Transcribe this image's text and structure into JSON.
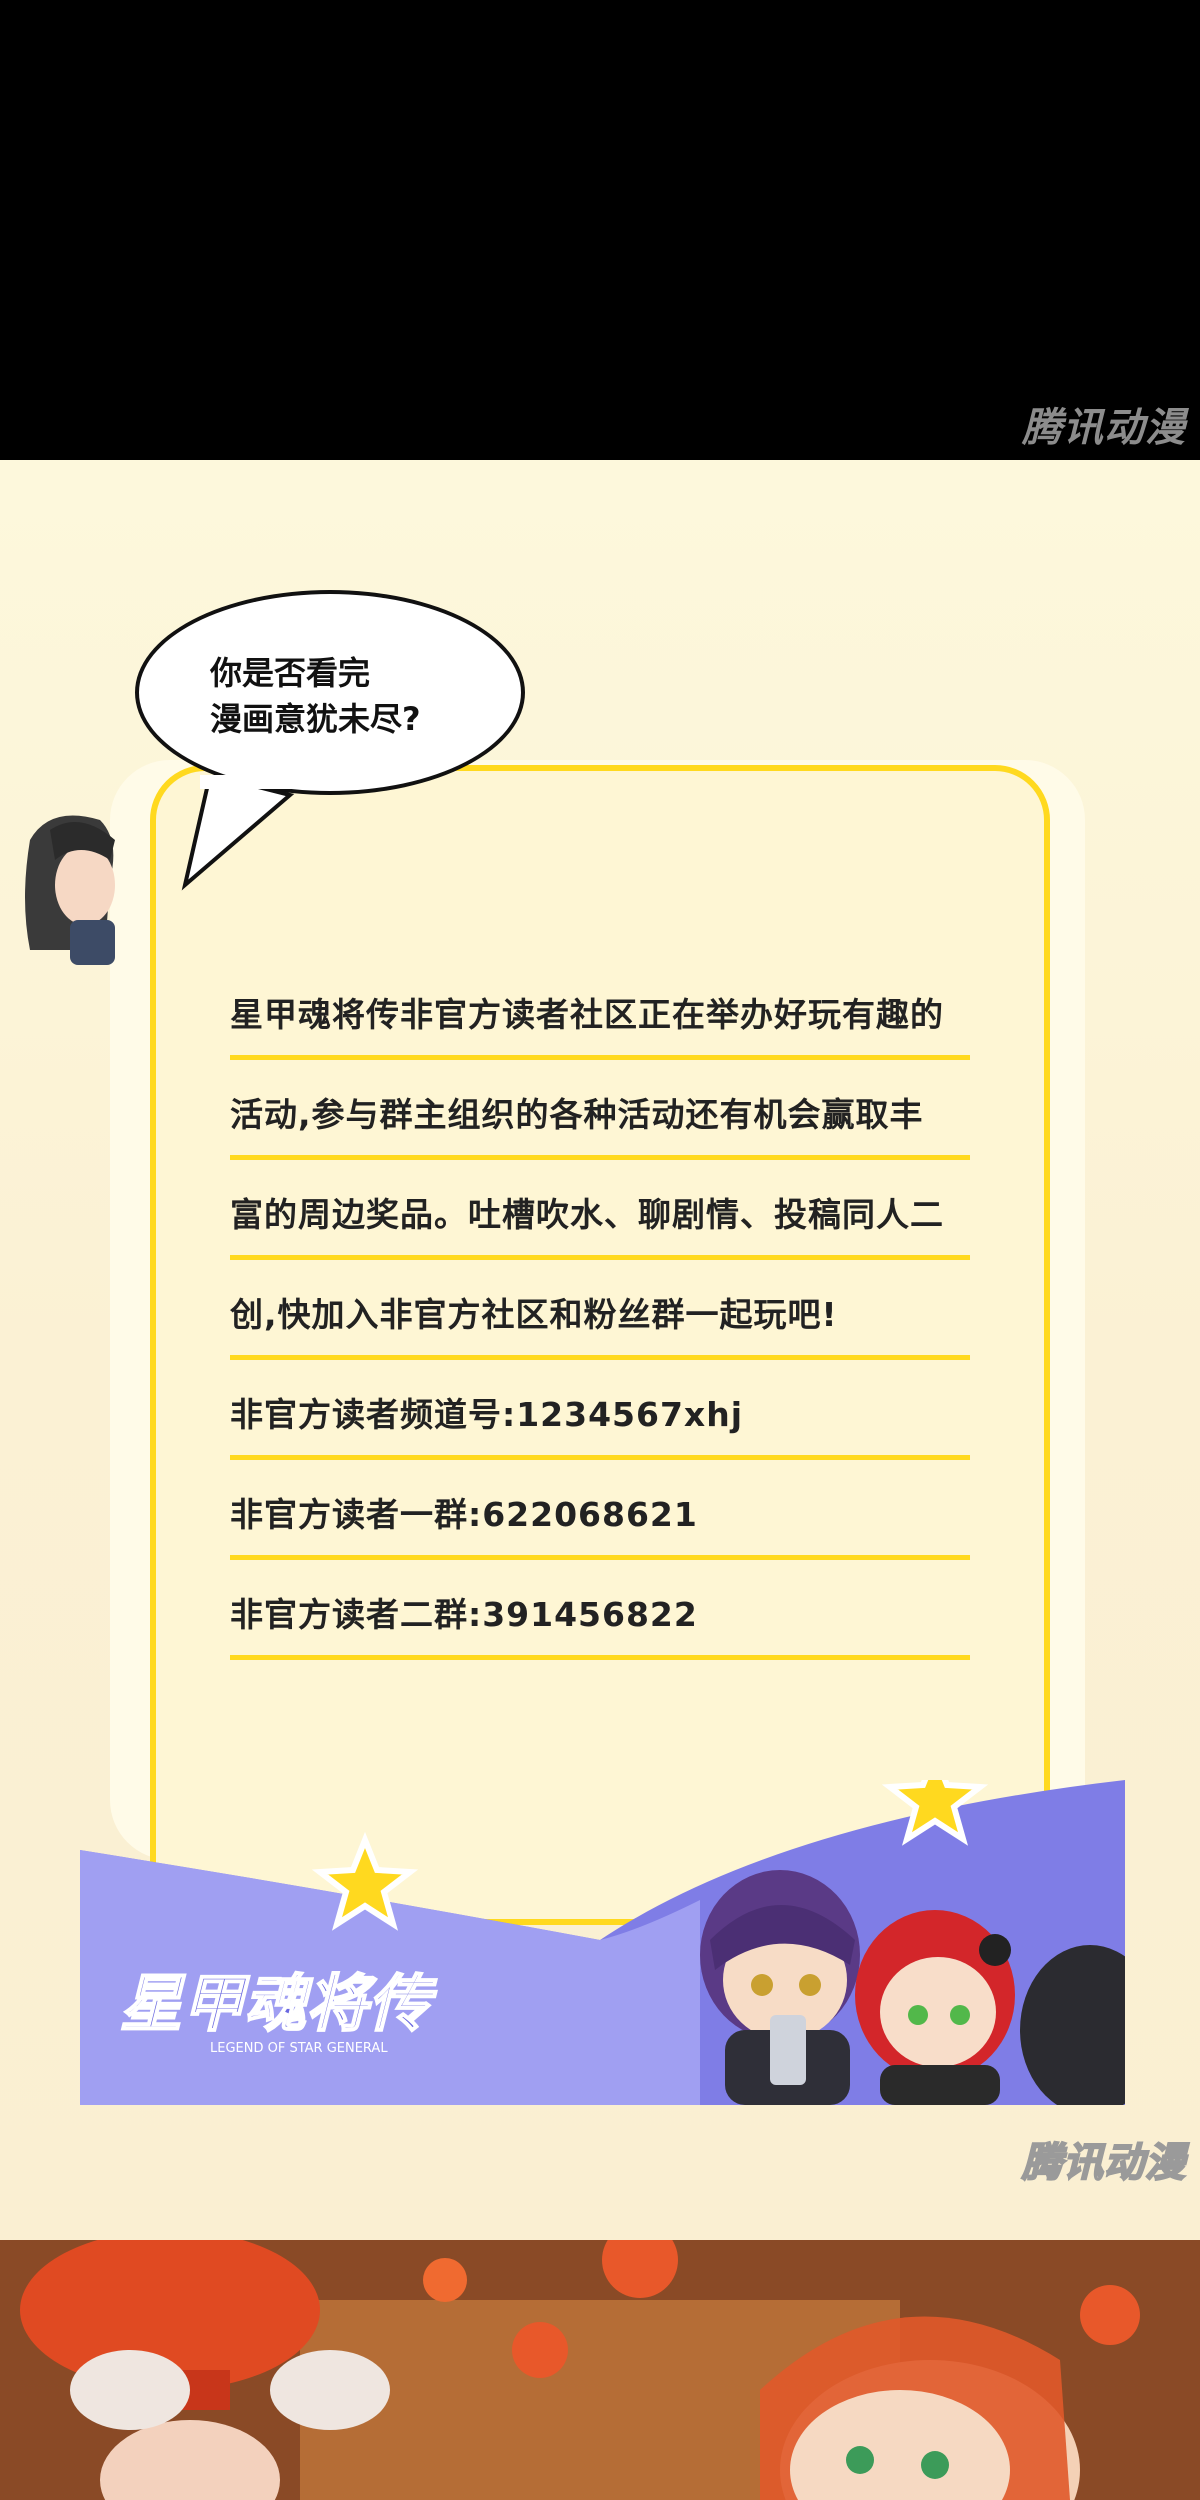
{
  "watermark": "腾讯动漫",
  "speech_bubble": {
    "lines": [
      "你是否看完",
      "漫画意犹未尽?"
    ]
  },
  "promo": {
    "lines": [
      "星甲魂将传非官方读者社区正在举办好玩有趣的",
      "活动,参与群主组织的各种活动还有机会赢取丰",
      "富的周边奖品。吐槽吹水、聊剧情、投稿同人二",
      "创,快加入非官方社区和粉丝群一起玩吧!",
      "非官方读者频道号:1234567xhj",
      "非官方读者一群:622068621",
      "非官方读者二群:391456822"
    ]
  },
  "logo": {
    "title": "星甲魂将传",
    "subtitle": "LEGEND OF STAR GENERAL"
  },
  "colors": {
    "accent_yellow": "#ffd91f",
    "banner_purple": "#8a88ea",
    "background": "#fdf6dc"
  }
}
